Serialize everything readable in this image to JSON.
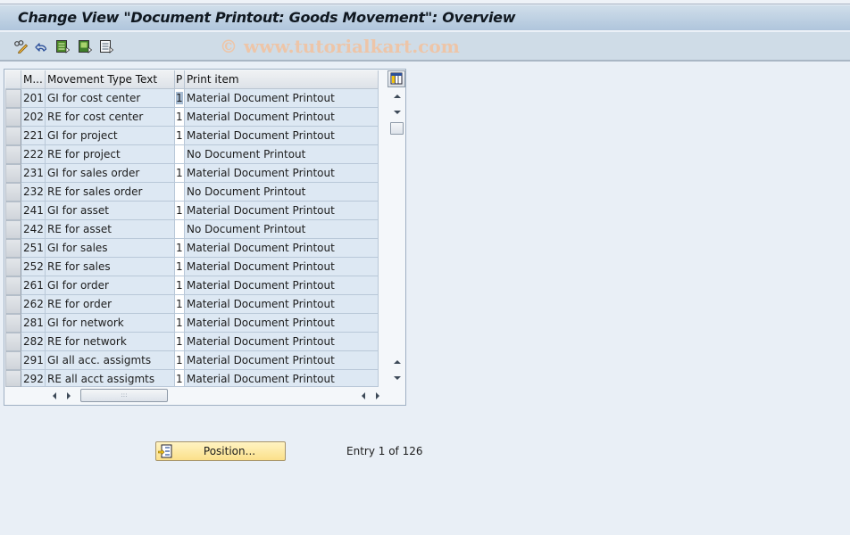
{
  "window": {
    "title": "Change View \"Document Printout: Goods Movement\": Overview"
  },
  "toolbar": {
    "buttons": [
      {
        "icon": "display-change-icon",
        "tooltip": "Display -> Change"
      },
      {
        "icon": "undo-icon",
        "tooltip": "Undo Change"
      },
      {
        "icon": "select-all-icon",
        "tooltip": "Select All"
      },
      {
        "icon": "select-block-icon",
        "tooltip": "Select Block"
      },
      {
        "icon": "deselect-all-icon",
        "tooltip": "Deselect All"
      }
    ],
    "watermark": "© www.tutorialkart.com"
  },
  "table": {
    "columns": [
      {
        "key": "mvt",
        "label": "M..."
      },
      {
        "key": "text",
        "label": "Movement Type Text"
      },
      {
        "key": "p",
        "label": "P"
      },
      {
        "key": "print_item",
        "label": "Print item"
      }
    ],
    "rows": [
      {
        "mvt": "201",
        "text": "GI for cost center",
        "p": "1",
        "print_item": "Material Document Printout"
      },
      {
        "mvt": "202",
        "text": "RE for cost center",
        "p": "1",
        "print_item": "Material Document Printout"
      },
      {
        "mvt": "221",
        "text": "GI for project",
        "p": "1",
        "print_item": "Material Document Printout"
      },
      {
        "mvt": "222",
        "text": "RE for project",
        "p": "",
        "print_item": "No Document Printout"
      },
      {
        "mvt": "231",
        "text": "GI for sales order",
        "p": "1",
        "print_item": "Material Document Printout"
      },
      {
        "mvt": "232",
        "text": "RE for sales order",
        "p": "",
        "print_item": "No Document Printout"
      },
      {
        "mvt": "241",
        "text": "GI for asset",
        "p": "1",
        "print_item": "Material Document Printout"
      },
      {
        "mvt": "242",
        "text": "RE for asset",
        "p": "",
        "print_item": "No Document Printout"
      },
      {
        "mvt": "251",
        "text": "GI for sales",
        "p": "1",
        "print_item": "Material Document Printout"
      },
      {
        "mvt": "252",
        "text": "RE for sales",
        "p": "1",
        "print_item": "Material Document Printout"
      },
      {
        "mvt": "261",
        "text": "GI for order",
        "p": "1",
        "print_item": "Material Document Printout"
      },
      {
        "mvt": "262",
        "text": "RE for order",
        "p": "1",
        "print_item": "Material Document Printout"
      },
      {
        "mvt": "281",
        "text": "GI for network",
        "p": "1",
        "print_item": "Material Document Printout"
      },
      {
        "mvt": "282",
        "text": "RE for network",
        "p": "1",
        "print_item": "Material Document Printout"
      },
      {
        "mvt": "291",
        "text": "GI all acc. assigmts",
        "p": "1",
        "print_item": "Material Document Printout"
      },
      {
        "mvt": "292",
        "text": "RE all acct assigmts",
        "p": "1",
        "print_item": "Material Document Printout"
      }
    ]
  },
  "footer": {
    "position_button": "Position...",
    "entry_info": "Entry 1 of 126"
  }
}
